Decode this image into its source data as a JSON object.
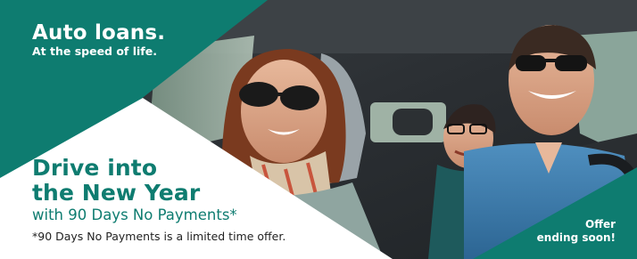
{
  "banner": {
    "headline": "Auto loans.",
    "tagline": "At the speed of life.",
    "promo_title_line1": "Drive into",
    "promo_title_line2": "the New Year",
    "promo_subtitle": "with 90 Days No Payments*",
    "disclaimer": "*90 Days No Payments is a limited time offer.",
    "offer_line1": "Offer",
    "offer_line2": "ending soon!"
  },
  "colors": {
    "brand_teal": "#0e7c70",
    "white": "#ffffff",
    "text_dark": "#222222"
  },
  "photo": {
    "subject": "family smiling in car"
  }
}
